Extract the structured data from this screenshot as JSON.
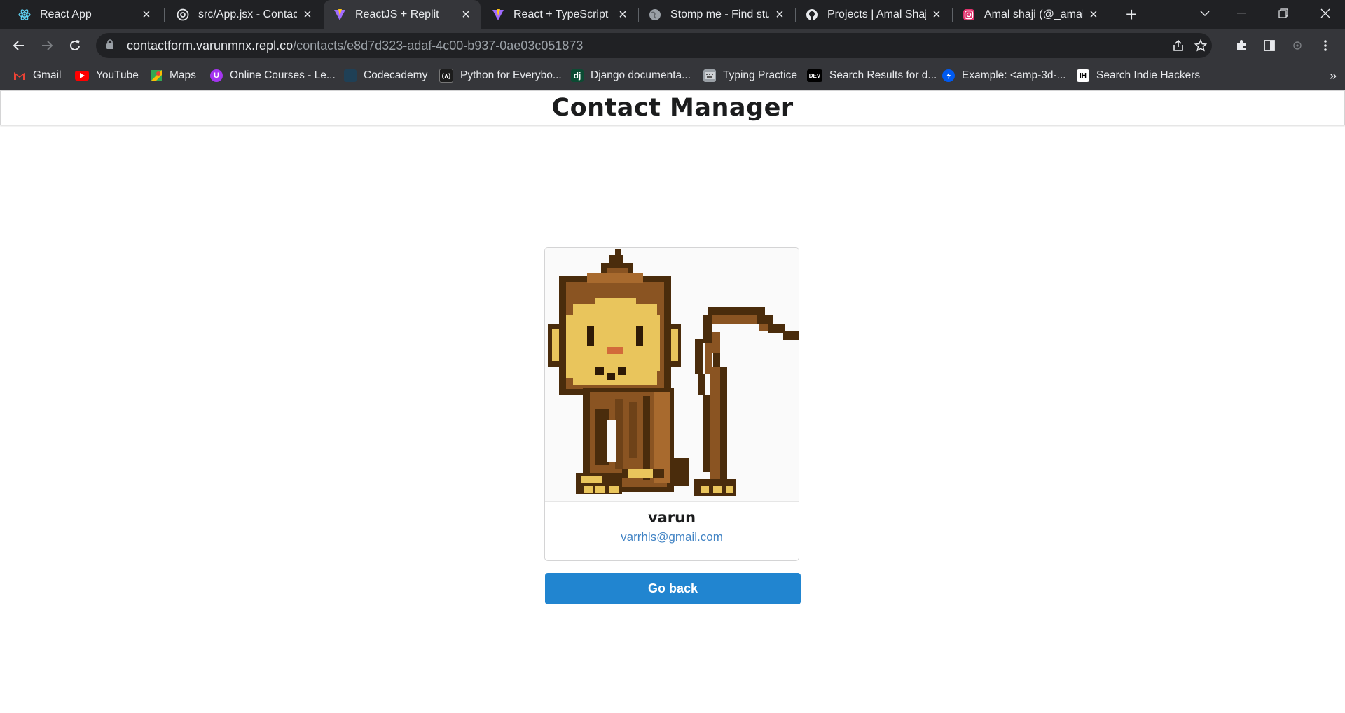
{
  "browser": {
    "tabs": [
      {
        "title": "React App",
        "icon": "react-icon",
        "active": false
      },
      {
        "title": "src/App.jsx - ContactF",
        "icon": "replit-icon",
        "active": false
      },
      {
        "title": "ReactJS + Replit",
        "icon": "vite-icon",
        "active": true
      },
      {
        "title": "React + TypeScript + ",
        "icon": "vite-icon",
        "active": false
      },
      {
        "title": "Stomp me - Find stud",
        "icon": "globe-icon",
        "active": false
      },
      {
        "title": "Projects | Amal Shaji",
        "icon": "github-icon",
        "active": false
      },
      {
        "title": "Amal shaji (@_amalsh",
        "icon": "instagram-icon",
        "active": false
      }
    ],
    "url_host": "contactform.varunmnx.repl.co",
    "url_path": "/contacts/e8d7d323-adaf-4c00-b937-0ae03c051873",
    "bookmarks": [
      {
        "label": "Gmail",
        "icon": "gmail-icon"
      },
      {
        "label": "YouTube",
        "icon": "youtube-icon"
      },
      {
        "label": "Maps",
        "icon": "maps-icon"
      },
      {
        "label": "Online Courses - Le...",
        "icon": "udemy-icon"
      },
      {
        "label": "Codecademy",
        "icon": "codecademy-icon"
      },
      {
        "label": "Python for Everybo...",
        "icon": "python-icon"
      },
      {
        "label": "Django documenta...",
        "icon": "django-icon"
      },
      {
        "label": "Typing Practice",
        "icon": "typing-icon"
      },
      {
        "label": "Search Results for d...",
        "icon": "dev-icon"
      },
      {
        "label": "Example: <amp-3d-...",
        "icon": "amp-icon"
      },
      {
        "label": "Search Indie Hackers",
        "icon": "indiehackers-icon"
      }
    ]
  },
  "app": {
    "title": "Contact Manager",
    "contact": {
      "name": "varun",
      "email": "varrhls@gmail.com",
      "avatar": "pixel-monkey-avatar"
    },
    "go_back_label": "Go back"
  },
  "colors": {
    "primary_button": "#2185d0",
    "email_link": "#4183c4",
    "chrome_dark": "#202124",
    "chrome_toolbar": "#35363a"
  }
}
